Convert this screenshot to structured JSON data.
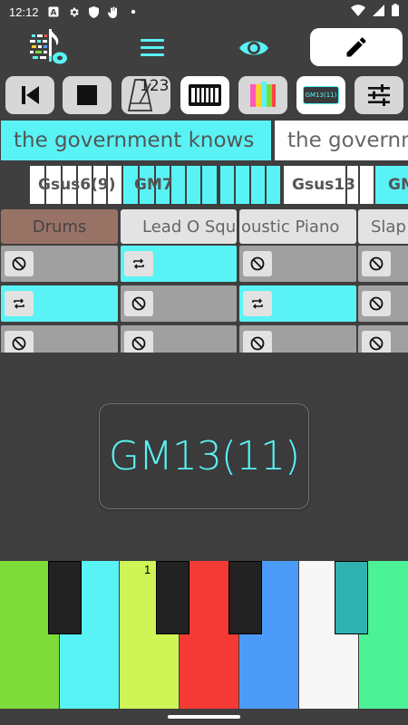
{
  "status_bar": {
    "time": "12:12",
    "icons": [
      "font-a-icon",
      "gear-icon",
      "shield-icon",
      "hand-icon",
      "dot-icon"
    ],
    "right_icons": [
      "wifi-icon",
      "signal-icon",
      "battery-icon"
    ]
  },
  "app_bar": {
    "logo": "piano-note-logo",
    "menu_icon": "hamburger-icon",
    "eye_icon": "eye-icon",
    "edit_icon": "pencil-icon"
  },
  "toolbar": {
    "tools": [
      {
        "name": "skip-back-icon"
      },
      {
        "name": "stop-icon"
      },
      {
        "name": "metronome-icon",
        "label": "123"
      },
      {
        "name": "keyboard-icon"
      },
      {
        "name": "colors-icon"
      },
      {
        "name": "chord-display-icon",
        "label": "GM13(11)"
      },
      {
        "name": "sliders-icon"
      }
    ]
  },
  "lyrics": {
    "current": "the government knows",
    "next": "the governm"
  },
  "chords": {
    "labels": [
      "Gsus6(9)",
      "GM7",
      "Gsus13",
      "GM"
    ]
  },
  "tracks": {
    "headers": [
      "Drums",
      "Lead O Squ",
      "oustic Piano",
      "Slap"
    ]
  },
  "chord_display": {
    "value": "GM13(11)"
  },
  "piano": {
    "marker": "1"
  },
  "colors": {
    "accent": "#59f3f5",
    "background": "#3f3f3f",
    "drums": "#997266",
    "cell_grey": "#a0a0a0"
  }
}
